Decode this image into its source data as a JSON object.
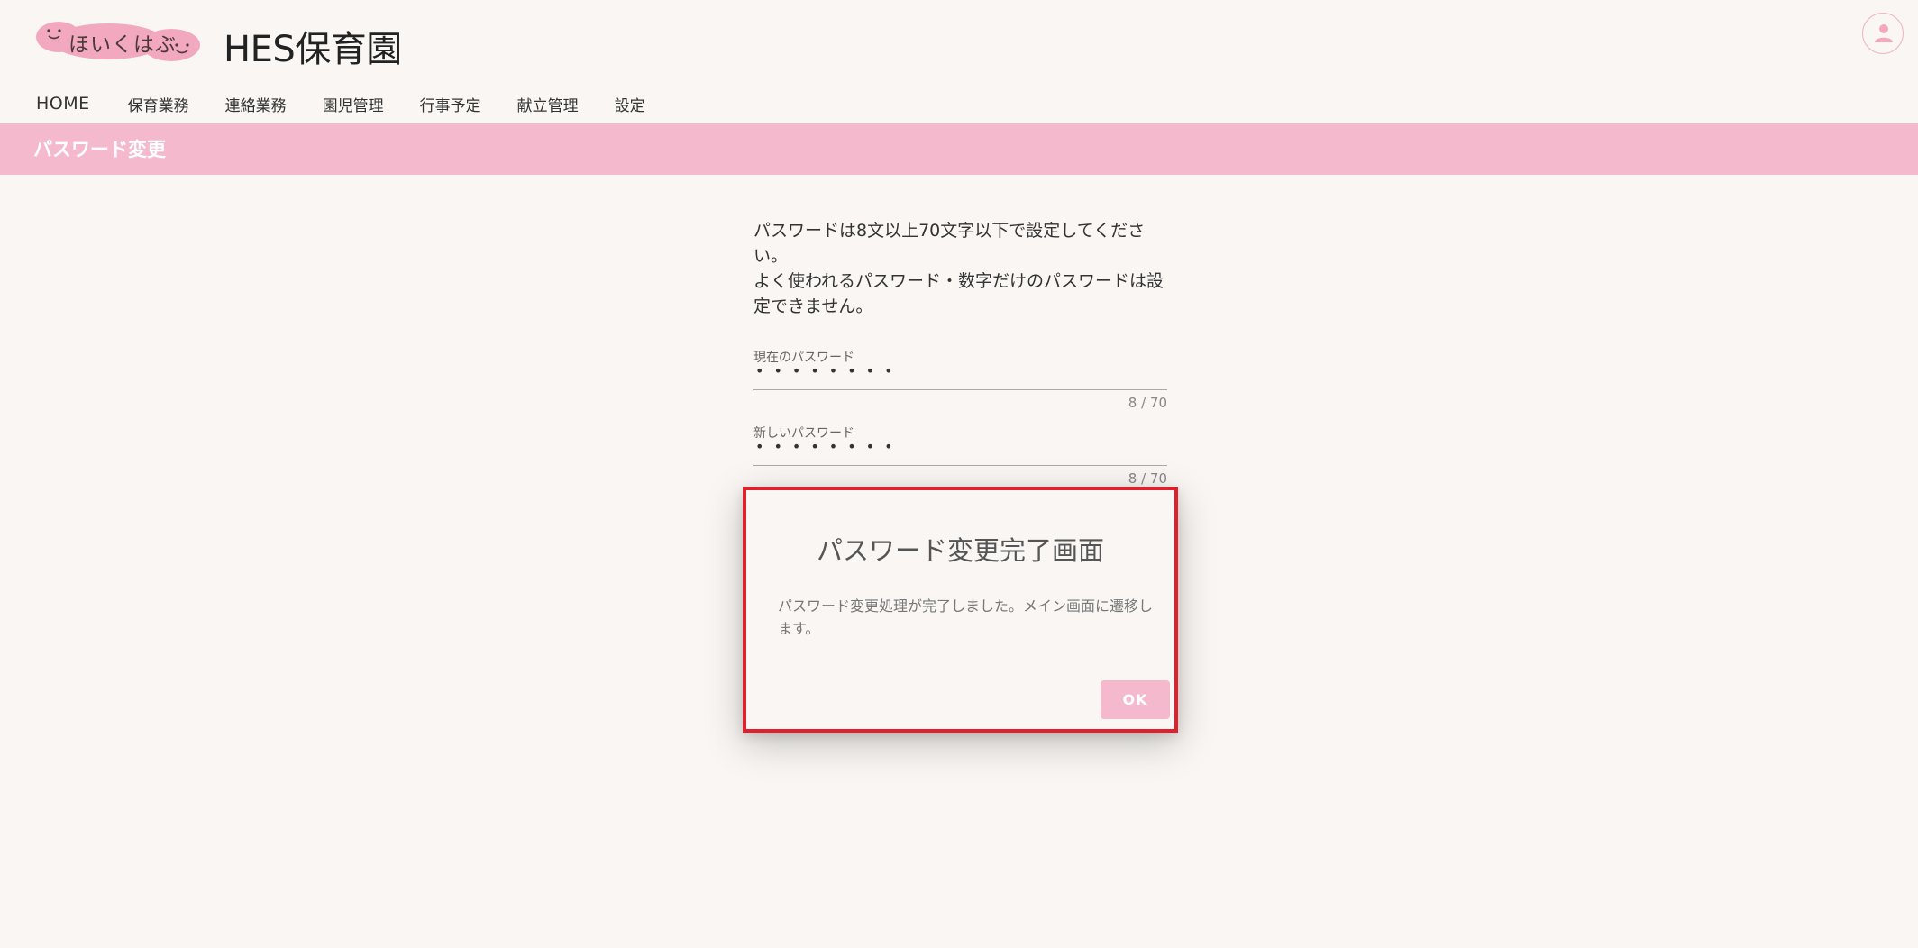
{
  "header": {
    "logo_text": "ほいくはぶ",
    "site_title": "HES保育園",
    "avatar_icon": "person-icon"
  },
  "nav": {
    "items": [
      {
        "label": "HOME"
      },
      {
        "label": "保育業務"
      },
      {
        "label": "連絡業務"
      },
      {
        "label": "園児管理"
      },
      {
        "label": "行事予定"
      },
      {
        "label": "献立管理"
      },
      {
        "label": "設定"
      }
    ]
  },
  "page": {
    "title": "パスワード変更"
  },
  "form": {
    "instructions": [
      "パスワードは8文以上70文字以下で設定してください。",
      "よく使われるパスワード・数字だけのパスワードは設定できません。"
    ],
    "current_password": {
      "label": "現在のパスワード",
      "value": "••••••••",
      "counter": "8 / 70"
    },
    "new_password": {
      "label": "新しいパスワード",
      "value": "••••••••",
      "counter": "8 / 70"
    }
  },
  "dialog": {
    "title": "パスワード変更完了画面",
    "message": "パスワード変更処理が完了しました。メイン画面に遷移します。",
    "ok_label": "OK"
  },
  "colors": {
    "accent_pink": "#f4b9cc",
    "highlight_border": "#e0202c",
    "background": "#f9f6f3"
  }
}
